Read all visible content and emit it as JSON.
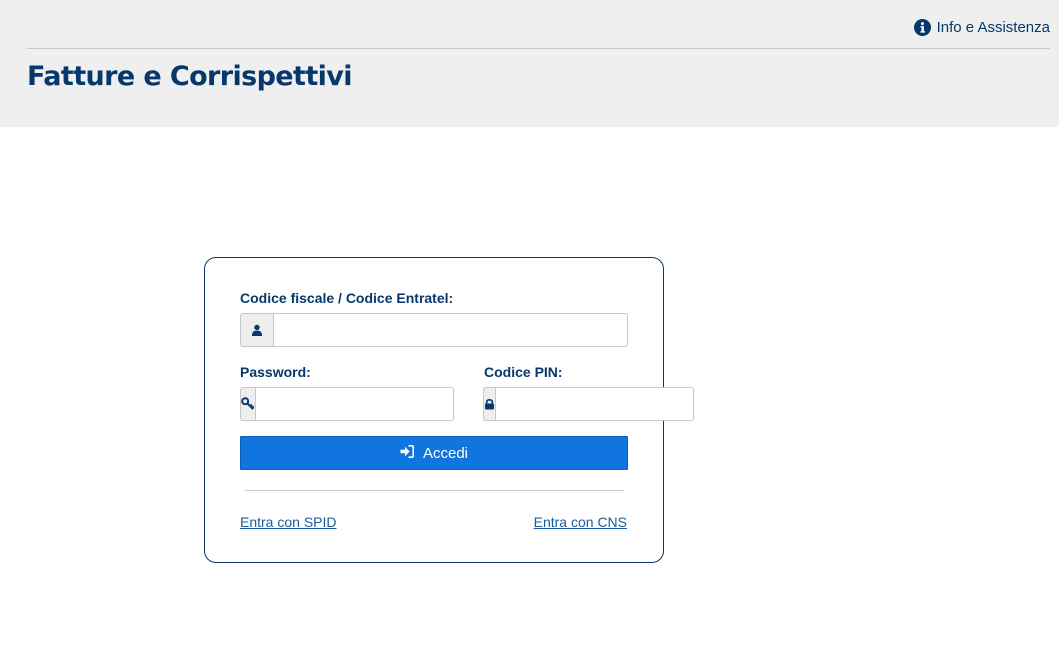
{
  "header": {
    "help_link": "Info e Assistenza",
    "title": "Fatture e Corrispettivi"
  },
  "login": {
    "codice_label": "Codice fiscale / Codice Entratel:",
    "codice_value": "",
    "password_label": "Password:",
    "password_value": "",
    "pin_label": "Codice PIN:",
    "pin_value": "",
    "submit_label": "Accedi",
    "spid_link": "Entra con SPID",
    "cns_link": "Entra con CNS"
  },
  "colors": {
    "brand": "#06386b",
    "button": "#1175e0",
    "header_bg": "#efefef"
  },
  "icons": [
    "info-icon",
    "user-icon",
    "key-icon",
    "lock-icon",
    "sign-in-icon"
  ]
}
